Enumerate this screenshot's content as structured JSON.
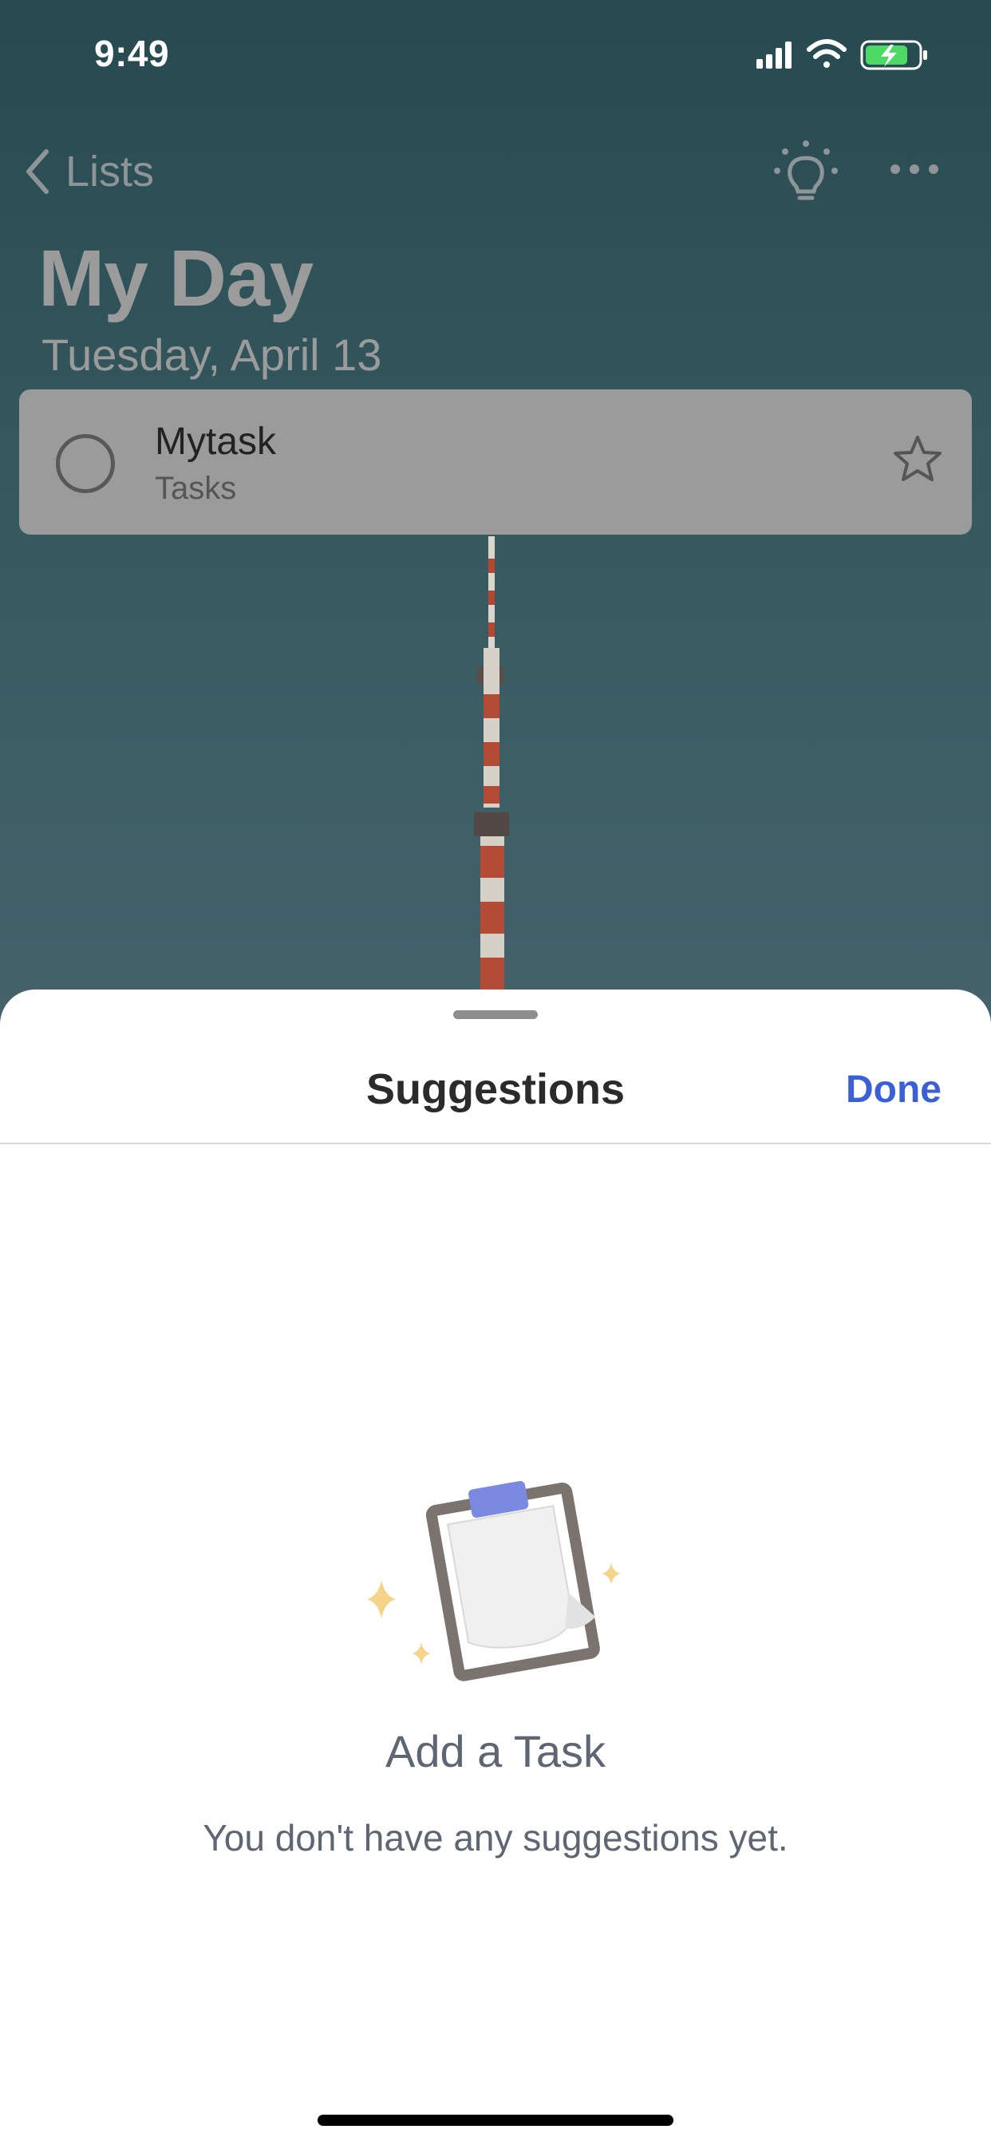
{
  "status_bar": {
    "time": "9:49",
    "icons": [
      "signal-icon",
      "wifi-icon",
      "battery-charging-icon"
    ]
  },
  "nav": {
    "back_label": "Lists",
    "icons": [
      "chevron-left-icon",
      "lightbulb-icon",
      "more-icon"
    ]
  },
  "header": {
    "title": "My Day",
    "date": "Tuesday, April 13"
  },
  "task": {
    "title": "Mytask",
    "list": "Tasks",
    "starred": false
  },
  "sheet": {
    "title": "Suggestions",
    "done_label": "Done",
    "empty_title": "Add a Task",
    "empty_message": "You don't have any suggestions yet."
  },
  "colors": {
    "accent": "#3b5fd6",
    "background": "#2f5357",
    "sparkle": "#f5d48a",
    "clip": "#7b8ae0"
  }
}
